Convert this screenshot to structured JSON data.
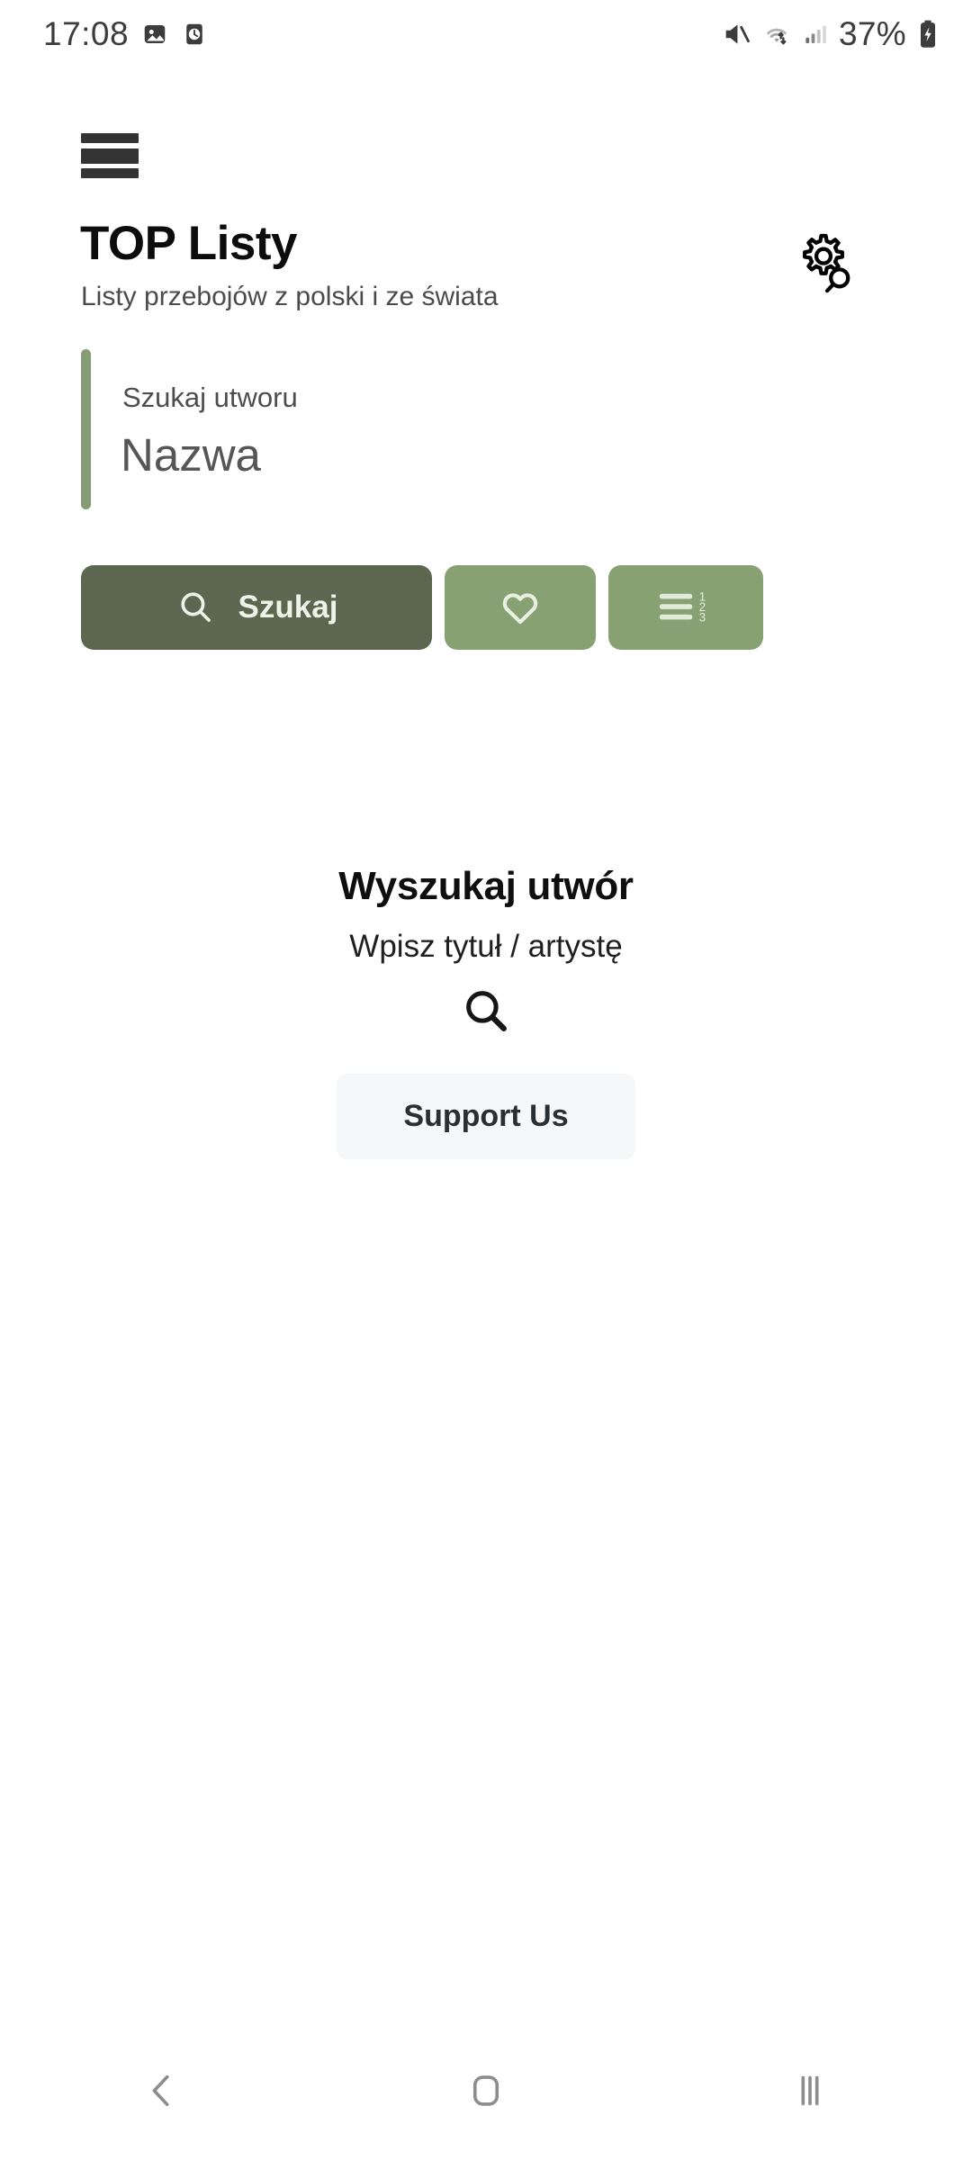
{
  "status_bar": {
    "time": "17:08",
    "battery_percent": "37%",
    "left_icons": [
      "photo-icon",
      "alarm-clock-icon"
    ],
    "right_icons": [
      "mute-icon",
      "wifi-icon",
      "cellular-signal-icon",
      "battery-charging-icon"
    ]
  },
  "app_bar": {
    "menu_icon": "hamburger-menu-icon",
    "title": "TOP Listy",
    "subtitle": "Listy przebojów z polski i ze świata",
    "settings_icon": "gear-search-icon"
  },
  "search_field": {
    "label": "Szukaj utworu",
    "value": "Nazwa",
    "accent_color": "#869B76"
  },
  "actions": {
    "search": {
      "label": "Szukaj",
      "icon": "search-icon",
      "color": "#5D6750"
    },
    "favorites": {
      "icon": "heart-icon",
      "color": "#87A173"
    },
    "ranking": {
      "icon": "numbered-list-icon",
      "color": "#87A173"
    }
  },
  "empty_state": {
    "title": "Wyszukaj utwór",
    "subtitle": "Wpisz tytuł / artystę",
    "icon": "search-icon",
    "support_label": "Support Us"
  },
  "nav_bar": {
    "back": "back-icon",
    "home": "home-icon",
    "recents": "recents-icon"
  }
}
